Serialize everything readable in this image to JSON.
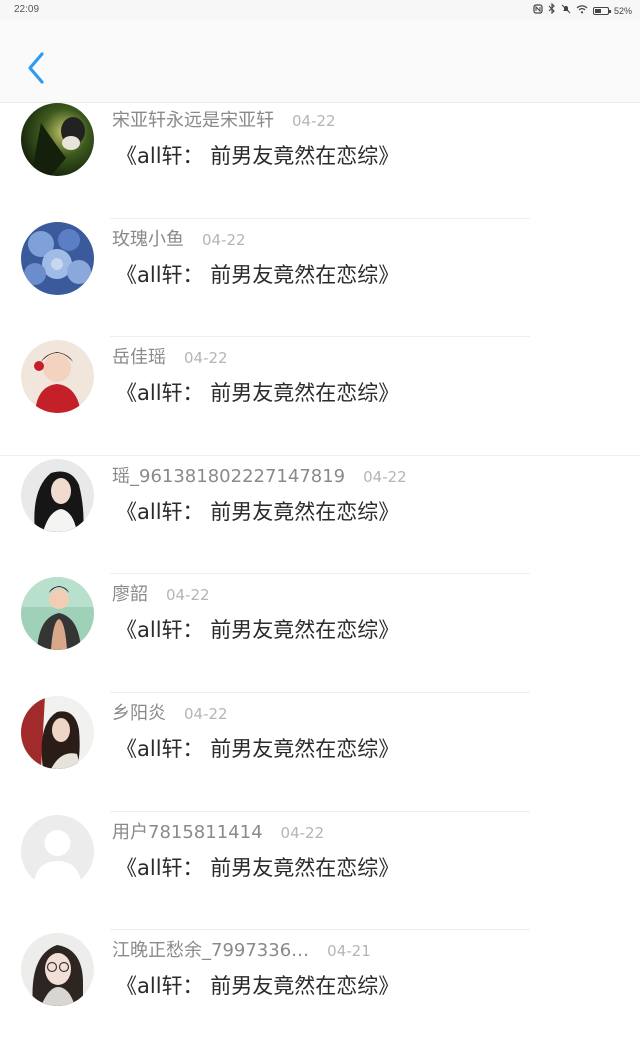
{
  "status_bar": {
    "time": "22:09",
    "battery": "52%",
    "battery_level": 0.52,
    "icons": [
      "nfc-icon",
      "bluetooth-icon",
      "mute-icon",
      "wifi-icon",
      "battery-icon"
    ]
  },
  "header": {
    "back_icon": "chevron-left-icon",
    "accent_color": "#2e9bf0"
  },
  "comments": [
    {
      "username": "宋亚轩永远是宋亚轩",
      "date": "04-22",
      "text": "《all轩： 前男友竟然在恋综》",
      "avatar": "dark-green-photo"
    },
    {
      "username": "玫瑰小鱼",
      "date": "04-22",
      "text": "《all轩： 前男友竟然在恋综》",
      "avatar": "blue-roses"
    },
    {
      "username": "岳佳瑶",
      "date": "04-22",
      "text": "《all轩： 前男友竟然在恋综》",
      "avatar": "girl-red-dress"
    },
    {
      "username": "瑶_9613818022271478​19",
      "date": "04-22",
      "text": "《all轩： 前男友竟然在恋综》",
      "avatar": "girl-dark-hair"
    },
    {
      "username": "廖韶",
      "date": "04-22",
      "text": "《all轩： 前男友竟然在恋综》",
      "avatar": "illustrated-boy"
    },
    {
      "username": "乡阳炎",
      "date": "04-22",
      "text": "《all轩： 前男友竟然在恋综》",
      "avatar": "girl-portrait"
    },
    {
      "username": "用户7815811414",
      "date": "04-22",
      "text": "《all轩： 前男友竟然在恋综》",
      "avatar": "default-avatar"
    },
    {
      "username": "江晚正愁余_7997336…",
      "date": "04-21",
      "text": "《all轩： 前男友竟然在恋综》",
      "avatar": "girl-glasses"
    }
  ]
}
